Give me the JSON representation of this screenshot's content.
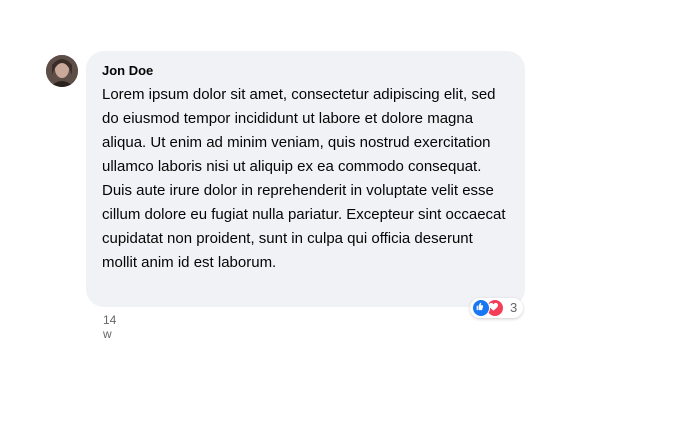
{
  "comment": {
    "author": "Jon Doe",
    "text": "Lorem ipsum dolor sit amet, consectetur adipiscing elit, sed do eiusmod tempor incididunt ut labore et dolore magna aliqua. Ut enim ad minim veniam, quis nostrud exercitation ullamco laboris nisi ut aliquip ex ea commodo consequat. Duis aute irure dolor in reprehenderit in voluptate velit esse cillum dolore eu fugiat nulla pariatur. Excepteur sint occaecat cupidatat non proident, sunt in culpa qui officia deserunt mollit anim id est laborum.",
    "timestamp": "14 w",
    "reactions": {
      "icons": [
        "like-icon",
        "love-icon"
      ],
      "count": "3"
    }
  },
  "colors": {
    "bubble_bg": "#f0f2f5",
    "like": "#1877f2",
    "love": "#f33e58",
    "meta_text": "#65676b"
  }
}
